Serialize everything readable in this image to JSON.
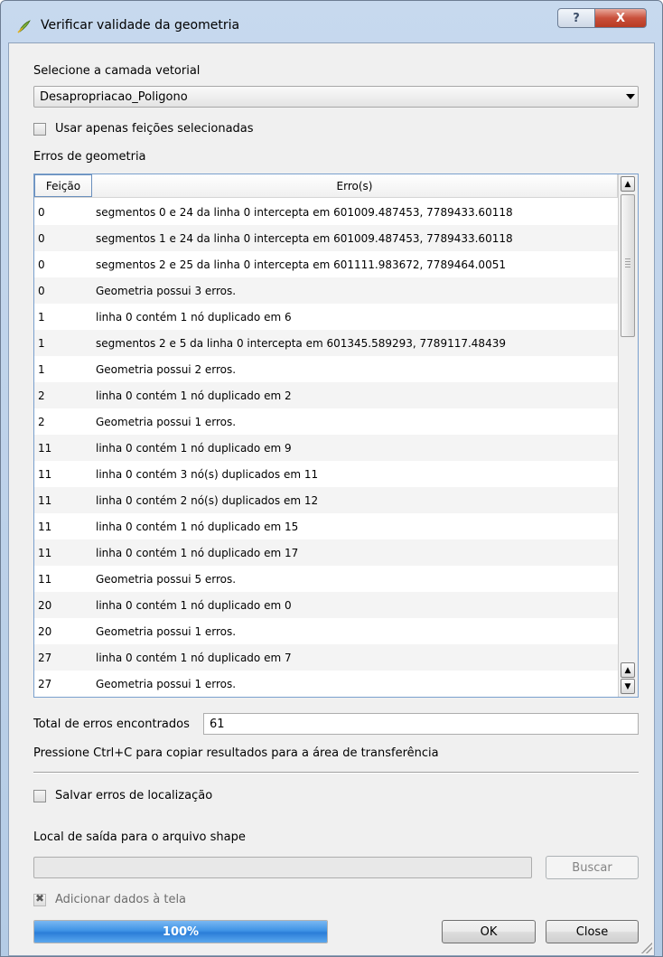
{
  "window": {
    "title": "Verificar validade da geometria",
    "help_label": "?",
    "close_label": "X"
  },
  "layer": {
    "label": "Selecione a camada vetorial",
    "selected": "Desapropriacao_Poligono"
  },
  "only_selected": {
    "label": "Usar apenas feições selecionadas",
    "checked": false
  },
  "errors": {
    "label": "Erros de geometria",
    "columns": [
      "Feição",
      "Erro(s)"
    ],
    "rows": [
      [
        "0",
        "segmentos 0 e 24 da linha 0 intercepta em 601009.487453, 7789433.60118"
      ],
      [
        "0",
        "segmentos 1 e 24 da linha 0 intercepta em 601009.487453, 7789433.60118"
      ],
      [
        "0",
        "segmentos 2 e 25 da linha 0 intercepta em 601111.983672, 7789464.0051"
      ],
      [
        "0",
        "Geometria possui 3 erros."
      ],
      [
        "1",
        "linha 0 contém 1 nó duplicado em 6"
      ],
      [
        "1",
        "segmentos 2 e 5 da linha 0 intercepta em 601345.589293, 7789117.48439"
      ],
      [
        "1",
        "Geometria possui 2 erros."
      ],
      [
        "2",
        "linha 0 contém 1 nó duplicado em 2"
      ],
      [
        "2",
        "Geometria possui 1 erros."
      ],
      [
        "11",
        "linha 0 contém 1 nó duplicado em 9"
      ],
      [
        "11",
        "linha 0 contém 3 nó(s) duplicados em 11"
      ],
      [
        "11",
        "linha 0 contém 2 nó(s) duplicados em 12"
      ],
      [
        "11",
        "linha 0 contém 1 nó duplicado em 15"
      ],
      [
        "11",
        "linha 0 contém 1 nó duplicado em 17"
      ],
      [
        "11",
        "Geometria possui 5 erros."
      ],
      [
        "20",
        "linha 0 contém 1 nó duplicado em 0"
      ],
      [
        "20",
        "Geometria possui 1 erros."
      ],
      [
        "27",
        "linha 0 contém 1 nó duplicado em 7"
      ],
      [
        "27",
        "Geometria possui 1 erros."
      ]
    ]
  },
  "total": {
    "label": "Total de erros encontrados",
    "value": "61"
  },
  "hint": "Pressione Ctrl+C para copiar resultados para a área de transferência",
  "save_errors": {
    "label": "Salvar erros de localização",
    "checked": false
  },
  "output": {
    "label": "Local de saída para o arquivo shape",
    "value": "",
    "browse_label": "Buscar"
  },
  "add_to_canvas": {
    "label": "Adicionar dados à tela",
    "checked": true
  },
  "progress": {
    "value": 100,
    "label": "100%"
  },
  "buttons": {
    "ok": "OK",
    "close": "Close"
  },
  "colors": {
    "progress_fill": "#3f93e6",
    "close_button": "#c9503b",
    "table_border": "#7aa0cd"
  }
}
